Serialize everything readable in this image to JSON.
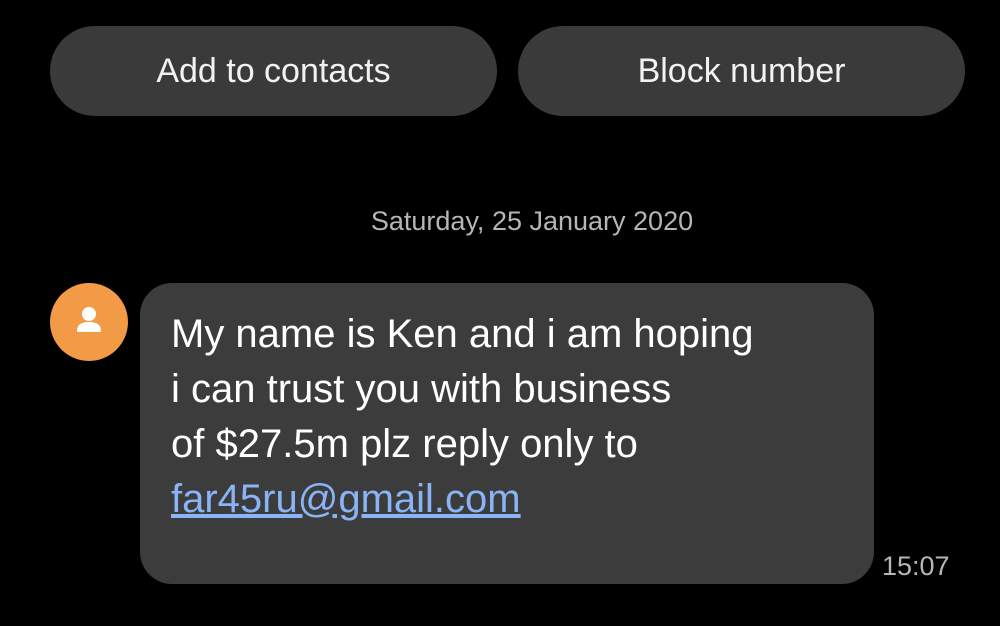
{
  "actions": {
    "add_contact_label": "Add to contacts",
    "block_label": "Block number"
  },
  "conversation": {
    "date_separator": "Saturday, 25 January 2020",
    "message": {
      "lines": [
        "My name is Ken and i am hoping",
        "i can trust you with business",
        "of $27.5m plz reply only to"
      ],
      "link": "far45ru@gmail.com",
      "time": "15:07"
    }
  },
  "colors": {
    "background": "#000000",
    "button_bg": "#3a3a3a",
    "bubble_bg": "#3c3c3c",
    "avatar_bg": "#f29a45",
    "link": "#8ab4f8",
    "secondary_text": "#b6b6b6"
  },
  "icons": {
    "avatar": "person-icon"
  }
}
